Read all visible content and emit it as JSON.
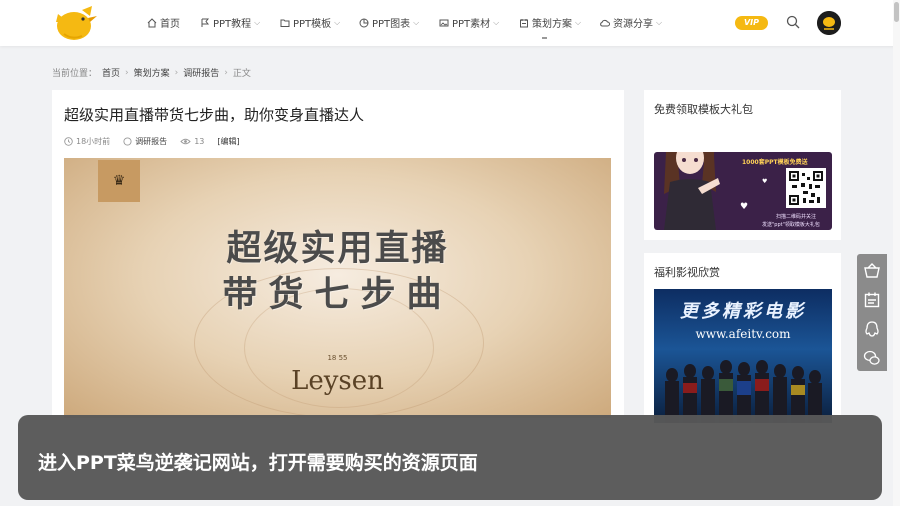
{
  "nav": {
    "items": [
      {
        "label": "首页",
        "has_menu": false
      },
      {
        "label": "PPT教程",
        "has_menu": true
      },
      {
        "label": "PPT模板",
        "has_menu": true
      },
      {
        "label": "PPT图表",
        "has_menu": true
      },
      {
        "label": "PPT素材",
        "has_menu": true
      },
      {
        "label": "策划方案",
        "has_menu": true
      },
      {
        "label": "资源分享",
        "has_menu": true
      }
    ],
    "vip_label": "VIP"
  },
  "breadcrumb": {
    "prefix": "当前位置：",
    "items": [
      "首页",
      "策划方案",
      "调研报告",
      "正文"
    ]
  },
  "article": {
    "title": "超级实用直播带货七步曲，助你变身直播达人",
    "time": "18小时前",
    "category": "调研报告",
    "views": "13",
    "edit": "[编辑]",
    "cover": {
      "line1": "超级实用直播",
      "line2": "带货七步曲",
      "brand": "Leysen",
      "year": "18 55"
    }
  },
  "sidebar": {
    "widget1": {
      "title": "免费领取模板大礼包",
      "promo_text": "1000套PPT模板免费送",
      "promo_sub1": "扫描二维码并关注",
      "promo_sub2": "发送\"ppt\"领取模板大礼包"
    },
    "widget2": {
      "title": "福利影视欣赏",
      "movie_title": "更多精彩电影",
      "movie_url": "www.afeitv.com"
    }
  },
  "caption": {
    "text": "进入PPT菜鸟逆袭记网站，打开需要购买的资源页面"
  },
  "colors": {
    "accent": "#f5b912",
    "caption_bg": "#585858",
    "page_bg": "#f1f2f4"
  }
}
